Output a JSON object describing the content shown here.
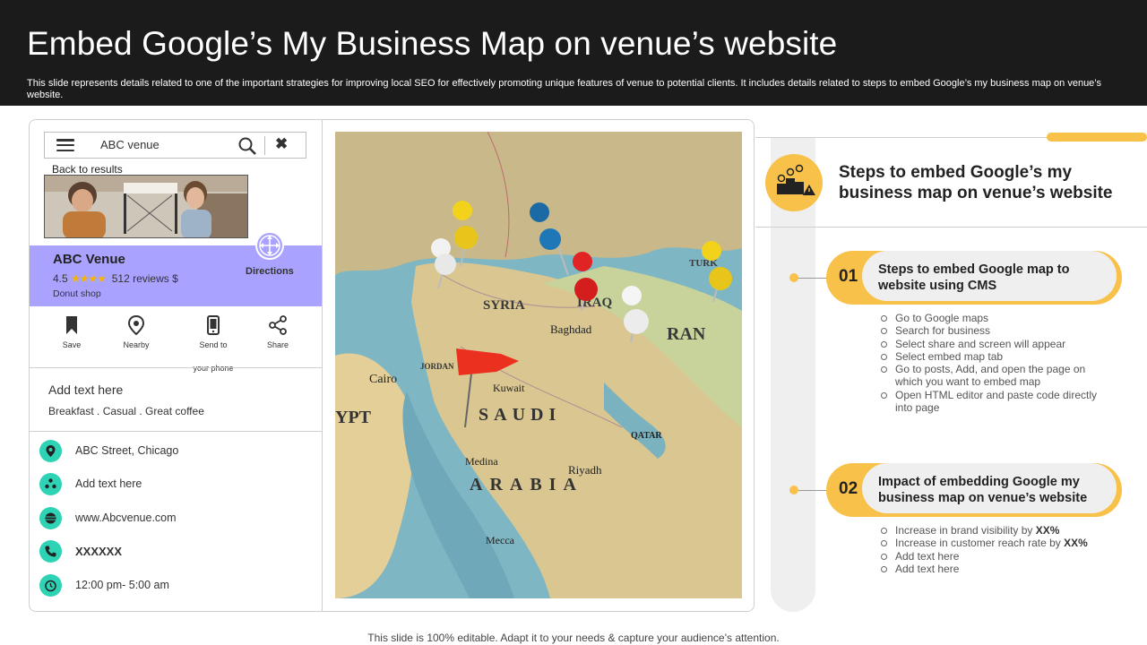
{
  "slide": {
    "title": "Embed Google’s My Business Map on venue’s website",
    "subtitle": "This slide represents details related to one of the important strategies for improving local SEO for effectively  promoting unique features of venue to potential clients. It includes details related to steps to embed Google’s my business map on venue’s website.",
    "footer": "This slide is 100% editable. Adapt it to your needs & capture your audience’s attention."
  },
  "listing": {
    "search_value": "ABC venue",
    "back_link": "Back to results",
    "venue_name": "ABC Venue",
    "rating": "4.5",
    "stars": "★★★★",
    "reviews": "512 reviews $",
    "category": "Donut shop",
    "directions": "Directions",
    "actions": {
      "save": "Save",
      "nearby": "Nearby",
      "send_line1": "Send to",
      "send_line2": "your phone",
      "share": "Share"
    },
    "add_text": "Add text here",
    "tags": "Breakfast . Casual . Great  coffee",
    "contacts": {
      "address": "ABC Street, Chicago",
      "extra": "Add text here",
      "website": "www.Abcvenue.com",
      "phone": "XXXXXX",
      "hours": "12:00 pm- 5:00 am"
    }
  },
  "map": {
    "labels": {
      "syria": "SYRIA",
      "iraq": "IRAQ",
      "iran": "RAN",
      "baghdad": "Baghdad",
      "saudi": "SAUDI",
      "arabia": "ARABIA",
      "kuwait": "Kuwait",
      "cairo": "Cairo",
      "jordan": "JORDAN",
      "egypt": "YPT",
      "riyadh": "Riyadh",
      "qatar": "QATAR",
      "medina": "Medina",
      "mecca": "Mecca",
      "turkey": "TURK"
    }
  },
  "steps": {
    "heading": "Steps to embed Google’s my business map on venue’s website",
    "items": [
      {
        "number": "01",
        "title": "Steps to embed Google map to website using CMS",
        "bullets": [
          "Go to Google maps",
          "Search for business",
          "Select share and screen will appear",
          "Select embed map tab",
          "Go to posts, Add, and open the page on which you want to  embed map",
          "Open HTML editor and paste code directly into page"
        ]
      },
      {
        "number": "02",
        "title": "Impact of embedding Google my business map on venue’s website",
        "bullets": [
          "Increase in brand visibility by",
          "Increase in customer reach rate by",
          "Add text here",
          "Add text here"
        ],
        "metric": "XX%"
      }
    ]
  },
  "colors": {
    "accent_yellow": "#f7c14a",
    "venue_purple": "#a9a3ff",
    "contact_teal": "#2ed3b5",
    "header_dark": "#1b1b1b"
  }
}
